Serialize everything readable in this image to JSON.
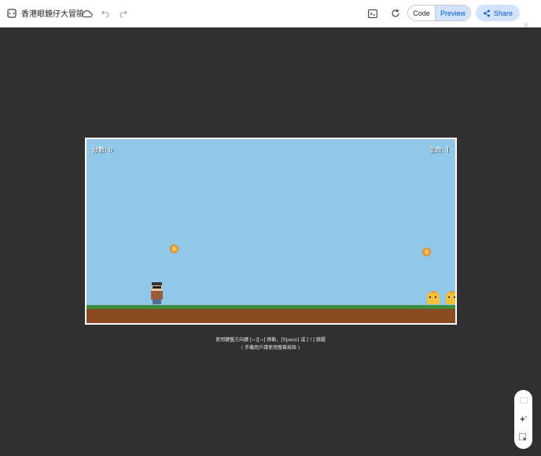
{
  "app": {
    "title": "香港眼鏡仔大冒險"
  },
  "toolbar": {
    "code_label": "Code",
    "preview_label": "Preview",
    "share_label": "Share"
  },
  "game": {
    "score_label": "分數: 0",
    "life_label": "生命: 1",
    "coin_symbol": "$"
  },
  "instructions": {
    "line1": "使用鍵盤方向鍵 [←][→] 移動，[Space] 或 [↑] 跳躍",
    "line2": "( 手機用戶請使用螢幕按鈕 )"
  },
  "icons": [
    "app-icon",
    "cloud-icon",
    "undo-icon",
    "redo-icon",
    "console-icon",
    "refresh-icon",
    "share-icon",
    "close-icon",
    "grid-icon",
    "sparkle-icon",
    "select-icon"
  ],
  "colors": {
    "sky": "#92c8e7",
    "grass": "#3f8c3a",
    "dirt": "#8a4a22",
    "coin": "#f0a63c",
    "accent": "#0b57d0",
    "background": "#303030"
  }
}
